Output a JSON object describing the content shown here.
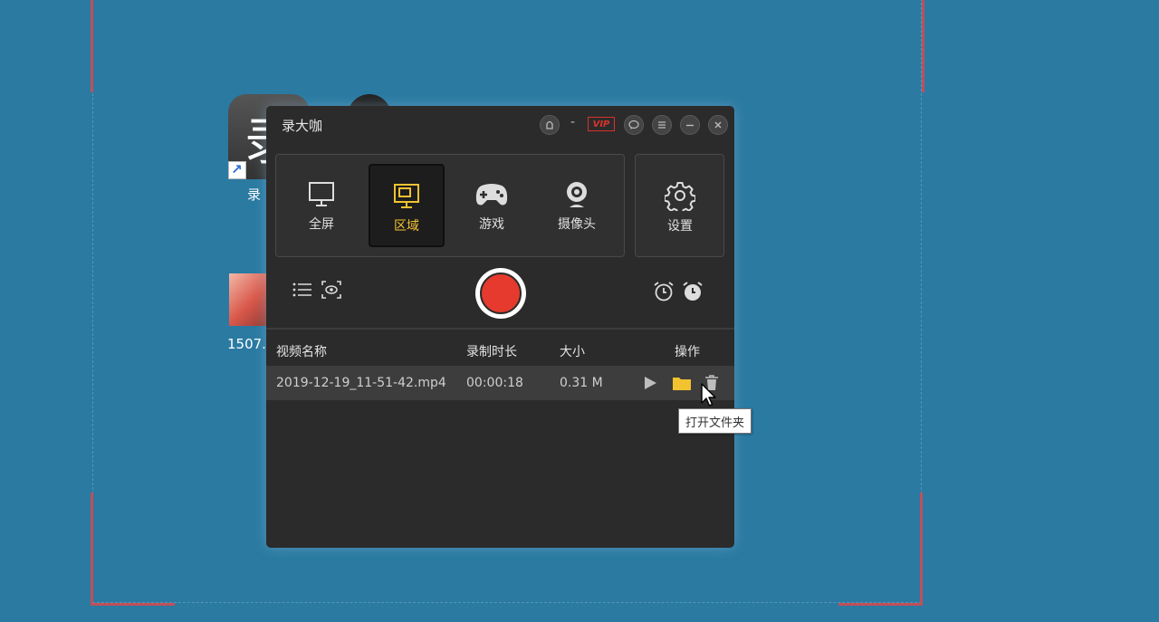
{
  "desktop": {
    "app_icon_char": "录",
    "app_label": "录",
    "file_label": "1507."
  },
  "window": {
    "title": "录大咖",
    "vip_badge": "VIP",
    "title_dash": "-",
    "title_buttons": [
      "skin-icon",
      "feedback-icon",
      "menu-icon",
      "minimize-icon",
      "close-icon"
    ]
  },
  "modes": [
    {
      "label": "全屏",
      "icon": "monitor-icon",
      "active": false
    },
    {
      "label": "区域",
      "icon": "region-monitor-icon",
      "active": true
    },
    {
      "label": "游戏",
      "icon": "gamepad-icon",
      "active": false
    },
    {
      "label": "摄像头",
      "icon": "webcam-icon",
      "active": false
    }
  ],
  "settings": {
    "label": "设置",
    "icon": "gear-icon"
  },
  "controls": {
    "left_icons": [
      "list-icon",
      "preview-icon"
    ],
    "right_icons": [
      "alarm-outline-icon",
      "alarm-filled-icon"
    ]
  },
  "table": {
    "headers": {
      "name": "视频名称",
      "duration": "录制时长",
      "size": "大小",
      "actions": "操作"
    },
    "rows": [
      {
        "name": "2019-12-19_11-51-42.mp4",
        "duration": "00:00:18",
        "size": "0.31 M",
        "actions": [
          "play-icon",
          "folder-icon",
          "trash-icon"
        ]
      }
    ]
  },
  "tooltip": "打开文件夹",
  "colors": {
    "accent": "#f2c230",
    "record": "#e63a2e",
    "vip": "#d9332a",
    "desktop": "#2a7aa2"
  }
}
